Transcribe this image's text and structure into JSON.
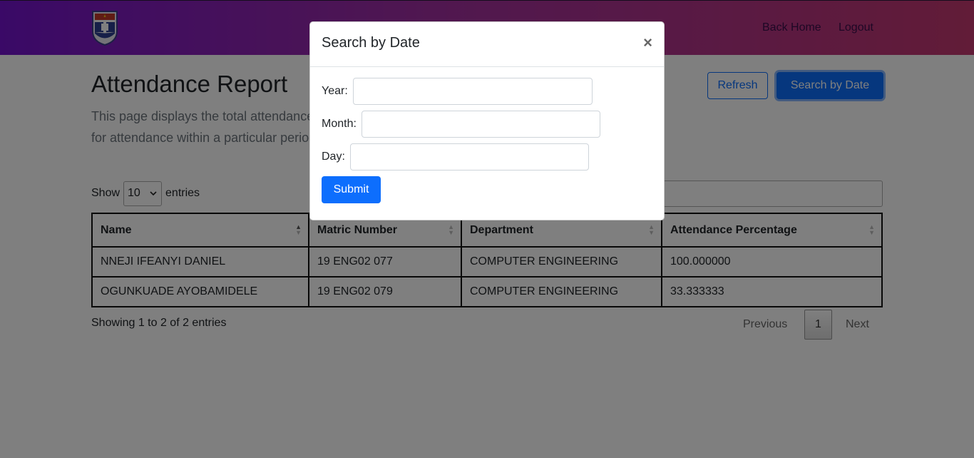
{
  "nav": {
    "back_home": "Back Home",
    "logout": "Logout",
    "logo_icon": "shield-crest-logo"
  },
  "page": {
    "title": "Attendance Report",
    "description": "This page displays the total attendance percentage of students in this course. You can search for attendance within a particular period using the Search By Date Button.",
    "refresh_label": "Refresh",
    "search_by_date_label": "Search by Date"
  },
  "table_controls": {
    "show_label": "Show",
    "entries_per_page": "10",
    "entries_label": "entries"
  },
  "table": {
    "columns": [
      "Name",
      "Matric Number",
      "Department",
      "Attendance Percentage"
    ],
    "rows": [
      [
        "NNEJI IFEANYI DANIEL",
        "19 ENG02 077",
        "COMPUTER ENGINEERING",
        "100.000000"
      ],
      [
        "OGUNKUADE AYOBAMIDELE",
        "19 ENG02 079",
        "COMPUTER ENGINEERING",
        "33.333333"
      ]
    ]
  },
  "footer": {
    "info": "Showing 1 to 2 of 2 entries",
    "previous": "Previous",
    "current_page": "1",
    "next": "Next"
  },
  "modal": {
    "title": "Search by Date",
    "close": "×",
    "year_label": "Year:",
    "month_label": "Month:",
    "day_label": "Day:",
    "year_value": "",
    "month_value": "",
    "day_value": "",
    "submit_label": "Submit"
  },
  "colors": {
    "primary": "#0d6efd",
    "nav_gradient_start": "#7413ce",
    "nav_gradient_end": "#c43870"
  }
}
